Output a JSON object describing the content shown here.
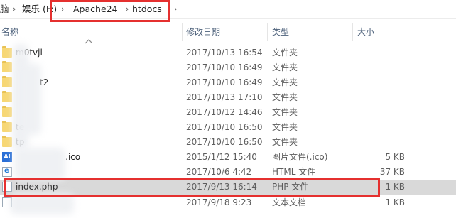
{
  "address_bar": {
    "segments": [
      "脑",
      "娱乐 (F:)",
      "Apache24",
      "htdocs"
    ]
  },
  "columns": {
    "name": "名称",
    "date": "修改日期",
    "type": "类型",
    "size": "大小"
  },
  "files": [
    {
      "name": "m0tvjl",
      "date": "2017/10/13 16:54",
      "type": "文件夹",
      "size": "",
      "icon": "folder-icon"
    },
    {
      "name": "",
      "date": "2017/10/10 16:49",
      "type": "文件夹",
      "size": "",
      "icon": "folder-icon"
    },
    {
      "name": "t2",
      "date": "2017/10/10 16:49",
      "type": "文件夹",
      "size": "",
      "icon": "folder-icon"
    },
    {
      "name": "",
      "date": "2017/10/13 17:10",
      "type": "文件夹",
      "size": "",
      "icon": "folder-icon"
    },
    {
      "name": "",
      "date": "2017/10/12 14:46",
      "type": "文件夹",
      "size": "",
      "icon": "folder-icon"
    },
    {
      "name": "te",
      "date": "2017/10/10 16:50",
      "type": "文件夹",
      "size": "",
      "icon": "folder-icon"
    },
    {
      "name": "tp",
      "date": "2017/10/10 16:50",
      "type": "文件夹",
      "size": "",
      "icon": "folder-icon"
    },
    {
      "name": ".ico",
      "date": "2015/1/12 15:40",
      "type": "图片文件(.ico)",
      "size": "5 KB",
      "icon": "ico-file-icon"
    },
    {
      "name": "",
      "date": "2017/10/6 4:42",
      "type": "HTML 文件",
      "size": "37 KB",
      "icon": "html-file-icon"
    },
    {
      "name": "index.php",
      "date": "2017/9/13 16:14",
      "type": "PHP 文件",
      "size": "1 KB",
      "icon": "php-file-icon",
      "selected": true
    },
    {
      "name": "",
      "date": "2017/9/18 9:23",
      "type": "文本文档",
      "size": "1 KB",
      "icon": "text-file-icon"
    }
  ],
  "colors": {
    "highlight_box": "#e5302f",
    "selected_row": "#d9d9d9",
    "header_text": "#4c607a"
  }
}
